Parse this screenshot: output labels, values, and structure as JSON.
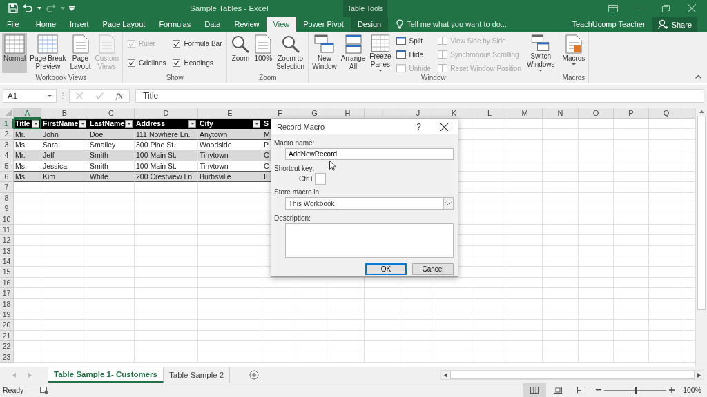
{
  "title_bar": {
    "title": "Sample Tables - Excel",
    "contextual_label": "Table Tools"
  },
  "ribbon_tabs": [
    {
      "label": "File",
      "selected": false,
      "kind": "normal"
    },
    {
      "label": "Home",
      "selected": false,
      "kind": "normal"
    },
    {
      "label": "Insert",
      "selected": false,
      "kind": "normal"
    },
    {
      "label": "Page Layout",
      "selected": false,
      "kind": "normal"
    },
    {
      "label": "Formulas",
      "selected": false,
      "kind": "normal"
    },
    {
      "label": "Data",
      "selected": false,
      "kind": "normal"
    },
    {
      "label": "Review",
      "selected": false,
      "kind": "normal"
    },
    {
      "label": "View",
      "selected": true,
      "kind": "normal"
    },
    {
      "label": "Power Pivot",
      "selected": false,
      "kind": "normal"
    },
    {
      "label": "Design",
      "selected": false,
      "kind": "contextual"
    }
  ],
  "tell_me": {
    "placeholder": "Tell me what you want to do..."
  },
  "user_name": "TeachUcomp Teacher",
  "share_button": "Share",
  "ribbon_groups": [
    {
      "label": "Workbook Views",
      "columns": [
        {
          "items": [
            {
              "kind": "large",
              "label": "Normal",
              "selected": true,
              "disabled": false,
              "dropdown": false
            }
          ]
        },
        {
          "items": [
            {
              "kind": "large",
              "label": "Page Break\nPreview",
              "selected": false,
              "disabled": false,
              "dropdown": false
            }
          ]
        },
        {
          "items": [
            {
              "kind": "large",
              "label": "Page\nLayout",
              "selected": false,
              "disabled": false,
              "dropdown": false
            }
          ]
        },
        {
          "items": [
            {
              "kind": "large",
              "label": "Custom\nViews",
              "selected": false,
              "disabled": true,
              "dropdown": false
            }
          ]
        }
      ]
    },
    {
      "label": "Show",
      "columns": [
        {
          "items": [
            {
              "kind": "checkbox",
              "label": "Ruler",
              "checked": true,
              "disabled": true
            },
            {
              "kind": "checkbox",
              "label": "Gridlines",
              "checked": true,
              "disabled": false
            }
          ]
        },
        {
          "items": [
            {
              "kind": "checkbox",
              "label": "Formula Bar",
              "checked": true,
              "disabled": false
            },
            {
              "kind": "checkbox",
              "label": "Headings",
              "checked": true,
              "disabled": false
            }
          ]
        }
      ]
    },
    {
      "label": "Zoom",
      "columns": [
        {
          "items": [
            {
              "kind": "large",
              "label": "Zoom",
              "disabled": false,
              "dropdown": false
            }
          ]
        },
        {
          "items": [
            {
              "kind": "large",
              "label": "100%",
              "disabled": false,
              "dropdown": false
            }
          ]
        },
        {
          "items": [
            {
              "kind": "large",
              "label": "Zoom to\nSelection",
              "disabled": false,
              "dropdown": false
            }
          ]
        }
      ]
    },
    {
      "label": "Window",
      "columns": [
        {
          "items": [
            {
              "kind": "large",
              "label": "New\nWindow",
              "disabled": false,
              "dropdown": false
            }
          ]
        },
        {
          "items": [
            {
              "kind": "large",
              "label": "Arrange\nAll",
              "disabled": false,
              "dropdown": false
            }
          ]
        },
        {
          "items": [
            {
              "kind": "large",
              "label": "Freeze\nPanes",
              "disabled": false,
              "dropdown": true
            }
          ]
        },
        {
          "items": [
            {
              "kind": "small",
              "label": "Split",
              "disabled": false
            },
            {
              "kind": "small",
              "label": "Hide",
              "disabled": false
            },
            {
              "kind": "small",
              "label": "Unhide",
              "disabled": true
            }
          ]
        },
        {
          "items": [
            {
              "kind": "small",
              "label": "View Side by Side",
              "disabled": true
            },
            {
              "kind": "small",
              "label": "Synchronous Scrolling",
              "disabled": true
            },
            {
              "kind": "small",
              "label": "Reset Window Position",
              "disabled": true
            }
          ]
        },
        {
          "items": [
            {
              "kind": "large",
              "label": "Switch\nWindows",
              "disabled": false,
              "dropdown": true
            }
          ]
        }
      ]
    },
    {
      "label": "Macros",
      "columns": [
        {
          "items": [
            {
              "kind": "large",
              "label": "Macros",
              "disabled": false,
              "dropdown": true
            }
          ]
        }
      ]
    }
  ],
  "formula_bar": {
    "name_box": "A1",
    "function_button": "fx",
    "value": "Title"
  },
  "columns": [
    {
      "label": "A",
      "selected": true
    },
    {
      "label": "B",
      "selected": false
    },
    {
      "label": "C",
      "selected": false
    },
    {
      "label": "D",
      "selected": false
    },
    {
      "label": "E",
      "selected": false
    },
    {
      "label": "F",
      "selected": false
    },
    {
      "label": "G",
      "selected": false
    },
    {
      "label": "H",
      "selected": false
    },
    {
      "label": "I",
      "selected": false
    },
    {
      "label": "J",
      "selected": false
    },
    {
      "label": "K",
      "selected": false
    },
    {
      "label": "L",
      "selected": false
    },
    {
      "label": "M",
      "selected": false
    },
    {
      "label": "N",
      "selected": false
    },
    {
      "label": "O",
      "selected": false
    },
    {
      "label": "P",
      "selected": false
    },
    {
      "label": "Q",
      "selected": false
    }
  ],
  "rows": [
    {
      "label": "1",
      "selected": true
    },
    {
      "label": "2",
      "selected": false
    },
    {
      "label": "3",
      "selected": false
    },
    {
      "label": "4",
      "selected": false
    },
    {
      "label": "5",
      "selected": false
    },
    {
      "label": "6",
      "selected": false
    },
    {
      "label": "7",
      "selected": false
    },
    {
      "label": "8",
      "selected": false
    },
    {
      "label": "9",
      "selected": false
    },
    {
      "label": "10",
      "selected": false
    },
    {
      "label": "11",
      "selected": false
    },
    {
      "label": "12",
      "selected": false
    },
    {
      "label": "13",
      "selected": false
    },
    {
      "label": "14",
      "selected": false
    },
    {
      "label": "15",
      "selected": false
    },
    {
      "label": "16",
      "selected": false
    },
    {
      "label": "17",
      "selected": false
    },
    {
      "label": "18",
      "selected": false
    },
    {
      "label": "19",
      "selected": false
    },
    {
      "label": "20",
      "selected": false
    },
    {
      "label": "21",
      "selected": false
    },
    {
      "label": "22",
      "selected": false
    },
    {
      "label": "23",
      "selected": false
    }
  ],
  "table": {
    "headers": [
      {
        "label": "Title",
        "filter": true
      },
      {
        "label": "FirstName",
        "filter": true
      },
      {
        "label": "LastName",
        "filter": true
      },
      {
        "label": "Address",
        "filter": true
      },
      {
        "label": "City",
        "filter": true
      },
      {
        "label": "S",
        "filter": false
      }
    ],
    "rows": [
      [
        "Mr.",
        "John",
        "Doe",
        "111 Nowhere Ln.",
        "Anytown",
        "M"
      ],
      [
        "Ms.",
        "Sara",
        "Smalley",
        "300 Pine St.",
        "Woodside",
        "P"
      ],
      [
        "Mr.",
        "Jeff",
        "Smith",
        "100 Main St.",
        "Tinytown",
        "C"
      ],
      [
        "Ms.",
        "Jessica",
        "Smith",
        "100 Main St.",
        "Tinytown",
        "C"
      ],
      [
        "Ms.",
        "Kim",
        "White",
        "200 Crestview Ln.",
        "Burbsville",
        "IL"
      ]
    ]
  },
  "dialog": {
    "title": "Record Macro",
    "help_button": "?",
    "macro_name_label": "Macro name:",
    "macro_name": "AddNewRecord",
    "shortcut_label": "Shortcut key:",
    "ctrl_label": "Ctrl+",
    "store_label": "Store macro in:",
    "store_value": "This Workbook",
    "description_label": "Description:",
    "ok_button": "OK",
    "cancel_button": "Cancel"
  },
  "sheet_tabs": [
    {
      "label": "Table Sample 1- Customers",
      "selected": true
    },
    {
      "label": "Table Sample 2",
      "selected": false
    }
  ],
  "status_bar": {
    "status": "Ready",
    "zoom": {
      "level": 0.5
    },
    "zoom_value": "100%",
    "views": [
      {
        "selected": true
      },
      {
        "selected": false
      },
      {
        "selected": false
      }
    ]
  }
}
